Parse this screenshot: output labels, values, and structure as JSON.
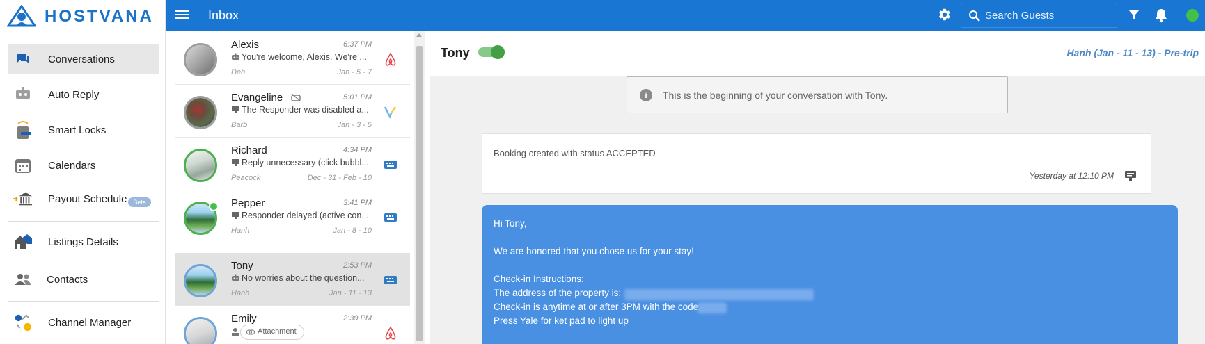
{
  "app": {
    "brand": "HOSTVANA"
  },
  "sidebar": {
    "items": [
      {
        "label": "Conversations",
        "icon": "chat-icon"
      },
      {
        "label": "Auto Reply",
        "icon": "robot-icon"
      },
      {
        "label": "Smart Locks",
        "icon": "smart-lock-icon"
      },
      {
        "label": "Calendars",
        "icon": "calendar-icon"
      },
      {
        "label": "Payout Schedule",
        "icon": "bank-icon",
        "badge": "Beta"
      },
      {
        "label": "Listings Details",
        "icon": "houses-icon"
      },
      {
        "label": "Contacts",
        "icon": "people-icon"
      },
      {
        "label": "Channel Manager",
        "icon": "channel-manager-icon"
      }
    ]
  },
  "topbar": {
    "title": "Inbox",
    "search_placeholder": "Search Guests",
    "status_color": "#43c049",
    "accent": "#1976d2"
  },
  "conversations": [
    {
      "name": "Alexis",
      "time": "6:37 PM",
      "message": "You're welcome, Alexis. We're ...",
      "message_icon": "robot-icon",
      "host": "Deb",
      "dates": "Jan - 5 - 7",
      "channel": "airbnb-icon"
    },
    {
      "name": "Evangeline",
      "time": "5:01 PM",
      "message": "The Responder was disabled a...",
      "message_icon": "responder-icon",
      "host": "Barb",
      "dates": "Jan - 3 - 5",
      "channel": "vrbo-icon",
      "name_icon": "robot-off-icon"
    },
    {
      "name": "Richard",
      "time": "4:34 PM",
      "message": "Reply unnecessary (click bubbl...",
      "message_icon": "responder-icon",
      "host": "Peacock",
      "dates": "Dec - 31 - Feb - 10",
      "channel": "keyboard-icon"
    },
    {
      "name": "Pepper",
      "time": "3:41 PM",
      "message": "Responder delayed (active con...",
      "message_icon": "responder-icon",
      "host": "Hanh",
      "dates": "Jan - 8 - 10",
      "channel": "keyboard-icon"
    },
    {
      "name": "Tony",
      "time": "2:53 PM",
      "message": "No worries about the question...",
      "message_icon": "robot-icon",
      "host": "Hanh",
      "dates": "Jan - 11 - 13",
      "channel": "keyboard-icon"
    },
    {
      "name": "Emily",
      "time": "2:39 PM",
      "message": "Attachment",
      "message_icon": "person-icon",
      "host": "",
      "dates": "",
      "channel": "airbnb-icon"
    }
  ],
  "chat": {
    "guest_name": "Tony",
    "trip_info": "Hanh (Jan - 11 - 13) - Pre-trip",
    "begin_text": "This is the beginning of your conversation with Tony.",
    "system_message": "Booking created with status ACCEPTED",
    "system_time": "Yesterday at 12:10 PM",
    "message_lines": [
      "Hi Tony,",
      "",
      "We are honored that you chose us for your stay!",
      "",
      "Check-in Instructions:",
      "The address of the property is:",
      "Check-in is anytime at or after 3PM with the code:",
      "Press Yale for ket pad to light up"
    ]
  }
}
